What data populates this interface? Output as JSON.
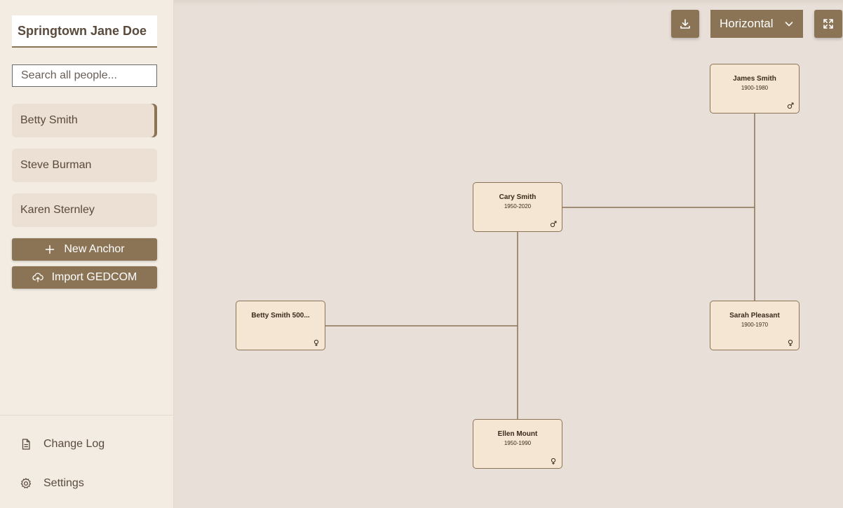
{
  "sidebar": {
    "tree_title": "Springtown Jane Doe",
    "search_placeholder": "Search all people...",
    "people": [
      "Betty Smith",
      "Steve Burman",
      "Karen Sternley"
    ],
    "new_anchor_label": "New Anchor",
    "import_label": "Import GEDCOM",
    "footer": {
      "change_log_label": "Change Log",
      "settings_label": "Settings"
    }
  },
  "toolbar": {
    "layout_value": "Horizontal"
  },
  "tree": {
    "nodes": {
      "james": {
        "name": "James Smith",
        "dates": "1900-1980",
        "gender": "male"
      },
      "cary": {
        "name": "Cary Smith",
        "dates": "1950-2020",
        "gender": "male"
      },
      "betty": {
        "name": "Betty Smith 500...",
        "dates": "",
        "gender": "female"
      },
      "sarah": {
        "name": "Sarah Pleasant",
        "dates": "1900-1970",
        "gender": "female"
      },
      "ellen": {
        "name": "Ellen Mount",
        "dates": "1950-1990",
        "gender": "female"
      }
    }
  },
  "colors": {
    "accent": "#8b7355",
    "canvas_bg": "#e8dfd8",
    "sidebar_bg": "#f2ece3",
    "node_bg": "#f5e6d3"
  }
}
